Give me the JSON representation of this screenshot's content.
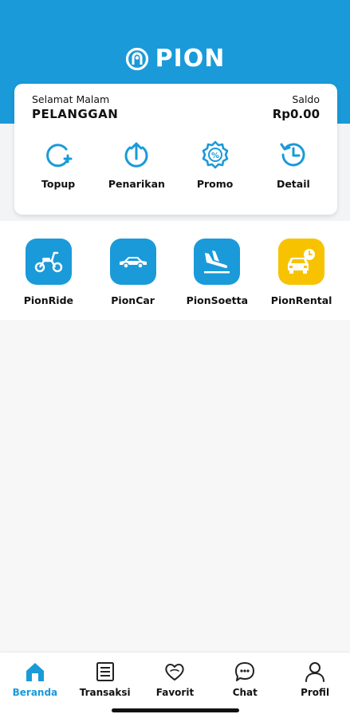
{
  "app": {
    "brand": "PION",
    "accent": "#1a9ad9",
    "rental_color": "#f7c300"
  },
  "account": {
    "greeting": "Selamat Malam",
    "user_name": "PELANGGAN",
    "balance_label": "Saldo",
    "balance_value": "Rp0.00"
  },
  "actions": [
    {
      "label": "Topup",
      "icon": "topup-icon"
    },
    {
      "label": "Penarikan",
      "icon": "withdraw-icon"
    },
    {
      "label": "Promo",
      "icon": "promo-icon"
    },
    {
      "label": "Detail",
      "icon": "history-icon"
    }
  ],
  "services": [
    {
      "label": "PionRide",
      "icon": "scooter-icon"
    },
    {
      "label": "PionCar",
      "icon": "car-icon"
    },
    {
      "label": "PionSoetta",
      "icon": "airplane-landing-icon"
    },
    {
      "label": "PionRental",
      "icon": "car-rental-icon"
    }
  ],
  "nav": [
    {
      "label": "Beranda",
      "icon": "home-icon",
      "active": true
    },
    {
      "label": "Transaksi",
      "icon": "list-icon",
      "active": false
    },
    {
      "label": "Favorit",
      "icon": "heart-icon",
      "active": false
    },
    {
      "label": "Chat",
      "icon": "chat-icon",
      "active": false
    },
    {
      "label": "Profil",
      "icon": "user-icon",
      "active": false
    }
  ]
}
